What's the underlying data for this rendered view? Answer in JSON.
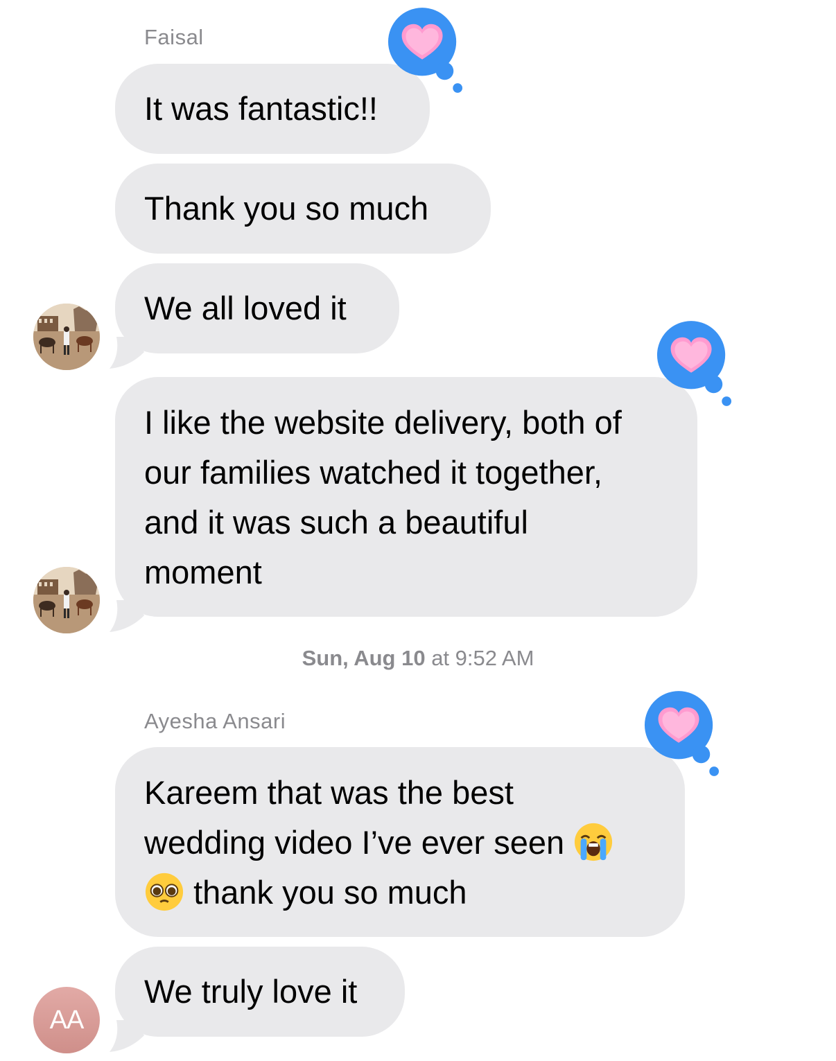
{
  "thread": {
    "messages": [
      {
        "sender": "Faisal",
        "text": "It was fantastic!!",
        "tapback": "heart"
      },
      {
        "text": "Thank you so much"
      },
      {
        "text": "We all loved it"
      },
      {
        "lines": [
          "I like the website delivery, both of",
          "our families watched it together,",
          "and it was such a beautiful",
          "moment"
        ],
        "tapback": "heart"
      }
    ],
    "timestamp": {
      "day": "Sun, Aug 10",
      "at": "at",
      "time": "9:52 AM"
    },
    "messages2": [
      {
        "sender": "Ayesha Ansari",
        "line1": "Kareem that was the best",
        "line2": "wedding video I’ve ever seen",
        "line3": "thank you so much",
        "emoji_crying": "loudly-crying-face-emoji",
        "emoji_pleading": "pleading-face-emoji",
        "tapback": "heart"
      },
      {
        "text": "We truly love it"
      }
    ],
    "avatars": {
      "faisal": "photo",
      "ayesha_initials": "AA"
    }
  },
  "colors": {
    "bubble": "#e9e9eb",
    "tapback": "#3a92f3",
    "heart": "#ff8fc8",
    "meta_text": "#8a8a8e"
  }
}
